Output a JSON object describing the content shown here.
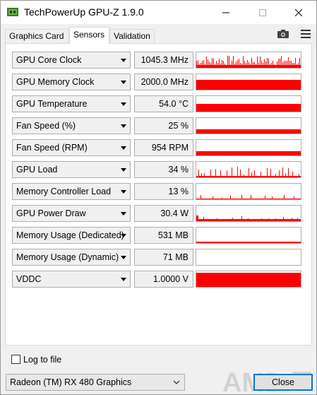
{
  "window": {
    "title": "TechPowerUp GPU-Z 1.9.0"
  },
  "tabs": [
    {
      "label": "Graphics Card"
    },
    {
      "label": "Sensors"
    },
    {
      "label": "Validation"
    }
  ],
  "sensors": [
    {
      "label": "GPU Core Clock",
      "value": "1045.3 MHz",
      "graph": "spiky-high"
    },
    {
      "label": "GPU Memory Clock",
      "value": "2000.0 MHz",
      "graph": "full"
    },
    {
      "label": "GPU Temperature",
      "value": "54.0 °C",
      "graph": "half"
    },
    {
      "label": "Fan Speed (%)",
      "value": "25 %",
      "graph": "low"
    },
    {
      "label": "Fan Speed (RPM)",
      "value": "954 RPM",
      "graph": "low"
    },
    {
      "label": "GPU Load",
      "value": "34 %",
      "graph": "spiky-mid"
    },
    {
      "label": "Memory Controller Load",
      "value": "13 %",
      "graph": "spiky-low"
    },
    {
      "label": "GPU Power Draw",
      "value": "30.4 W",
      "graph": "power"
    },
    {
      "label": "Memory Usage (Dedicated)",
      "value": "531 MB",
      "graph": "thin"
    },
    {
      "label": "Memory Usage (Dynamic)",
      "value": "71 MB",
      "graph": "empty"
    },
    {
      "label": "VDDC",
      "value": "1.0000 V",
      "graph": "full-tall"
    }
  ],
  "log_to_file": {
    "label": "Log to file",
    "checked": false
  },
  "gpu_select": {
    "value": "Radeon (TM) RX 480 Graphics"
  },
  "close_button": {
    "label": "Close"
  },
  "logo": {
    "text": "AMD"
  },
  "colors": {
    "graph": "#ff0000",
    "accent": "#0078d7"
  }
}
